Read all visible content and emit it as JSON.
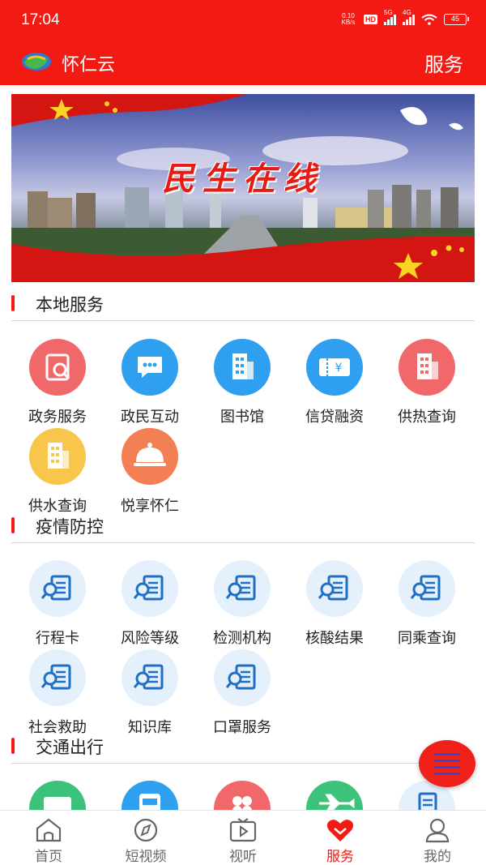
{
  "status_bar": {
    "time": "17:04",
    "net_speed_value": "0.10",
    "net_speed_unit": "KB/s",
    "hd": "HD",
    "signal1": "5G",
    "signal2": "4G",
    "battery": "45"
  },
  "app_bar": {
    "title": "怀仁云",
    "right_label": "服务"
  },
  "banner": {
    "text": "民生在线"
  },
  "sections": {
    "local": {
      "title": "本地服务",
      "items": [
        {
          "label": "政务服务",
          "icon": "government-service-icon",
          "color": "#f0686a"
        },
        {
          "label": "政民互动",
          "icon": "chat-icon",
          "color": "#2f9ff0"
        },
        {
          "label": "图书馆",
          "icon": "building-icon",
          "color": "#2f9ff0"
        },
        {
          "label": "信贷融资",
          "icon": "ticket-yen-icon",
          "color": "#2f9ff0"
        },
        {
          "label": "供热查询",
          "icon": "building-icon",
          "color": "#f0686a"
        },
        {
          "label": "供水查询",
          "icon": "building-icon",
          "color": "#f7c64a"
        },
        {
          "label": "悦享怀仁",
          "icon": "food-cloche-icon",
          "color": "#f37f55"
        }
      ]
    },
    "epidemic": {
      "title": "疫情防控",
      "items": [
        {
          "label": "行程卡",
          "icon": "search-document-icon"
        },
        {
          "label": "风险等级",
          "icon": "search-document-icon"
        },
        {
          "label": "检测机构",
          "icon": "search-document-icon"
        },
        {
          "label": "核酸结果",
          "icon": "search-document-icon"
        },
        {
          "label": "同乘查询",
          "icon": "search-document-icon"
        },
        {
          "label": "社会救助",
          "icon": "search-document-icon"
        },
        {
          "label": "知识库",
          "icon": "search-document-icon"
        },
        {
          "label": "口罩服务",
          "icon": "search-document-icon"
        }
      ]
    },
    "traffic": {
      "title": "交通出行",
      "items": [
        {
          "icon": "card-icon",
          "color": "#3cc27a"
        },
        {
          "icon": "bus-icon",
          "color": "#2f9ff0"
        },
        {
          "icon": "apps-icon",
          "color": "#f0686a"
        },
        {
          "icon": "airplane-icon",
          "color": "#3cc27a"
        },
        {
          "icon": "document-icon",
          "color": "#2f9ff0"
        }
      ]
    }
  },
  "bottom_nav": [
    {
      "label": "首页",
      "icon": "home-icon"
    },
    {
      "label": "短视频",
      "icon": "compass-icon"
    },
    {
      "label": "视听",
      "icon": "tv-play-icon"
    },
    {
      "label": "服务",
      "icon": "heart-icon",
      "active": true
    },
    {
      "label": "我的",
      "icon": "user-icon"
    }
  ],
  "fab": {
    "icon": "menu-icon"
  },
  "colors": {
    "brand": "#f31a14",
    "epidemic_icon_bg": "#e4f1fd",
    "epidemic_icon_fg": "#1f6fc4"
  }
}
